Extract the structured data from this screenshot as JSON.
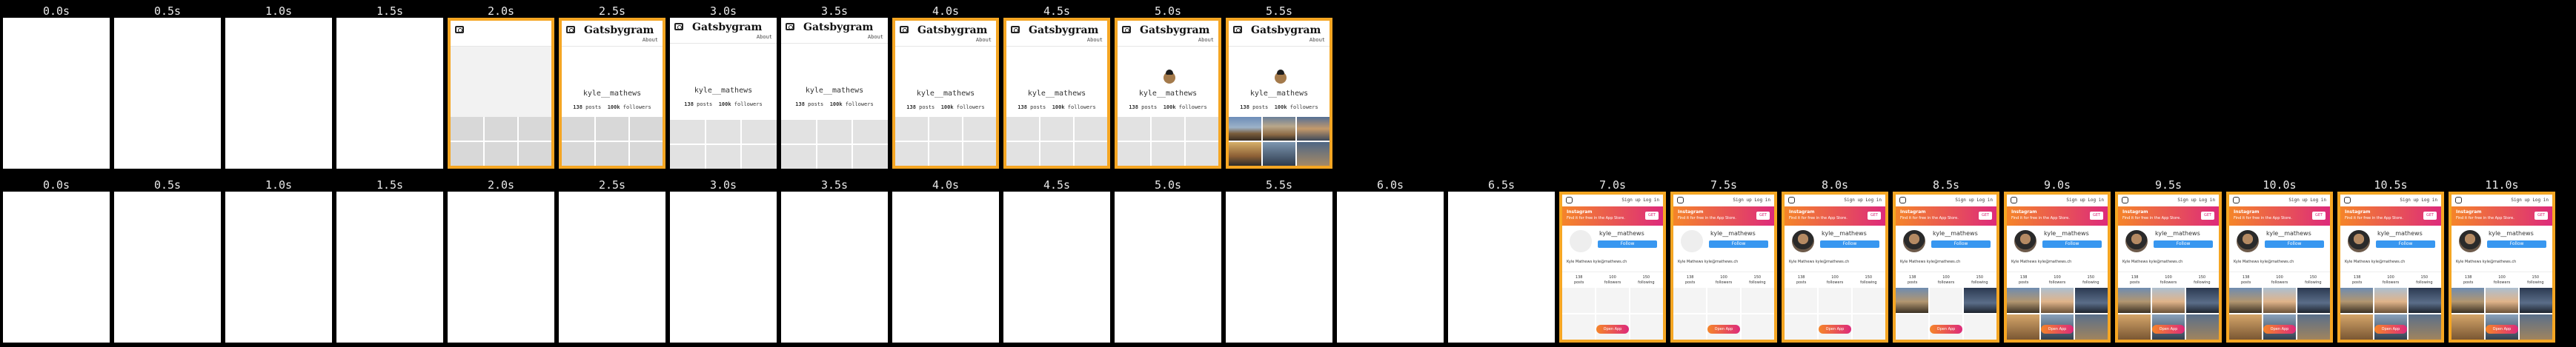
{
  "strip1": {
    "labels": [
      "0.0s",
      "0.5s",
      "1.0s",
      "1.5s",
      "2.0s",
      "2.5s",
      "3.0s",
      "3.5s",
      "4.0s",
      "4.5s",
      "5.0s",
      "5.5s"
    ]
  },
  "strip2": {
    "labels": [
      "0.0s",
      "0.5s",
      "1.0s",
      "1.5s",
      "2.0s",
      "2.5s",
      "3.0s",
      "3.5s",
      "4.0s",
      "4.5s",
      "5.0s",
      "5.5s",
      "6.0s",
      "6.5s",
      "7.0s",
      "7.5s",
      "8.0s",
      "8.5s",
      "9.0s",
      "9.5s",
      "10.0s",
      "10.5s",
      "11.0s"
    ]
  },
  "gatsbygram": {
    "title": "Gatsbygram",
    "about": "About",
    "username": "kyle__mathews",
    "posts": "138",
    "posts_label": "posts",
    "followers": "100k",
    "followers_label": "followers"
  },
  "instagram": {
    "top_right": "Sign up  Log in",
    "banner_title": "Instagram",
    "banner_sub": "Find it for free in the App Store.",
    "get": "GET",
    "username": "kyle__mathews",
    "follow": "Follow",
    "bio": "Kyle Mathews kyle@mathews.ch",
    "stat1_num": "138",
    "stat1_label": "posts",
    "stat2_num": "100",
    "stat2_label": "followers",
    "stat3_num": "150",
    "stat3_label": "following",
    "open_app": "Open App"
  },
  "colors": {
    "highlight": "#f5a623",
    "background": "#000000",
    "instagram_gradient_start": "#f58529",
    "instagram_gradient_end": "#dd2a7b",
    "follow_blue": "#3897f0"
  }
}
